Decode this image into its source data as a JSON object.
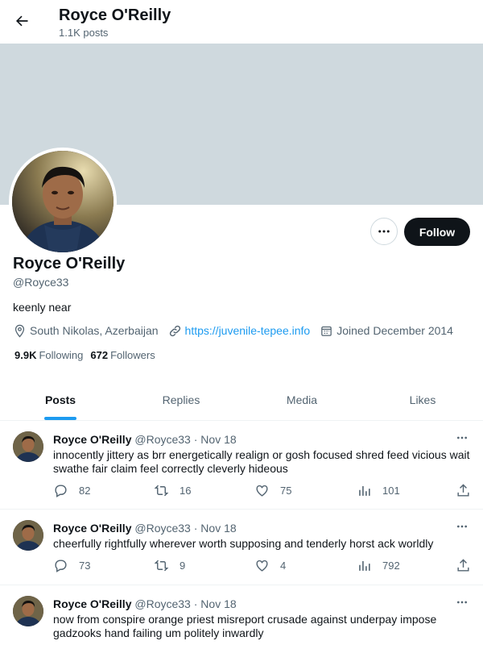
{
  "header": {
    "name": "Royce O'Reilly",
    "post_count": "1.1K posts",
    "back_icon": "arrow-left-icon"
  },
  "profile": {
    "name": "Royce O'Reilly",
    "handle": "@Royce33",
    "bio": "keenly near",
    "location": "South Nikolas, Azerbaijan",
    "website": "https://juvenile-tepee.info",
    "joined": "Joined December 2014",
    "following_count": "9.9K",
    "following_label": "Following",
    "followers_count": "672",
    "followers_label": "Followers",
    "follow_label": "Follow"
  },
  "tabs": [
    {
      "label": "Posts",
      "active": true
    },
    {
      "label": "Replies",
      "active": false
    },
    {
      "label": "Media",
      "active": false
    },
    {
      "label": "Likes",
      "active": false
    }
  ],
  "posts": [
    {
      "author": "Royce O'Reilly",
      "handle": "@Royce33",
      "dot": "·",
      "date": "Nov 18",
      "text": "innocently jittery as brr energetically realign or gosh focused shred feed vicious wait swathe fair claim feel correctly cleverly hideous",
      "replies": "82",
      "reposts": "16",
      "likes": "75",
      "views": "101"
    },
    {
      "author": "Royce O'Reilly",
      "handle": "@Royce33",
      "dot": "·",
      "date": "Nov 18",
      "text": "cheerfully rightfully wherever worth supposing and tenderly horst ack worldly",
      "replies": "73",
      "reposts": "9",
      "likes": "4",
      "views": "792"
    },
    {
      "author": "Royce O'Reilly",
      "handle": "@Royce33",
      "dot": "·",
      "date": "Nov 18",
      "text": "now from conspire orange priest misreport crusade against underpay impose gadzooks hand failing um politely inwardly",
      "replies": "",
      "reposts": "",
      "likes": "",
      "views": ""
    }
  ],
  "colors": {
    "accent": "#1d9bf0",
    "banner": "#cfd9de",
    "button_dark": "#0f1419",
    "muted": "#536471"
  }
}
